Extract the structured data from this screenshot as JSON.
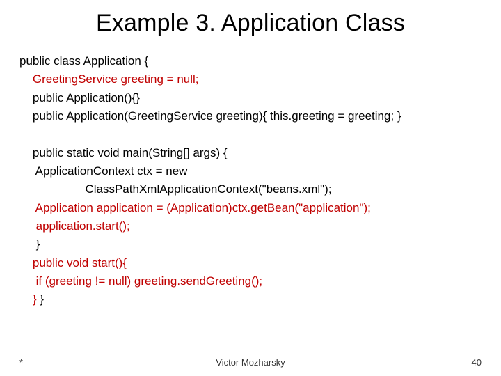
{
  "title": "Example 3. Application Class",
  "code": {
    "l1": "public class Application {",
    "l2": "    GreetingService greeting = null;",
    "l3": "    public Application(){}",
    "l4": "    public Application(GreetingService greeting){ this.greeting = greeting; }",
    "l5": "",
    "l6": "    public static void main(String[] args) {",
    "l7": "     ApplicationContext ctx = new",
    "l8": "                    ClassPathXmlApplicationContext(\"beans.xml\");",
    "l9": "     Application application = (Application)ctx.getBean(\"application\");",
    "l10": "     application.start();",
    "l11": "     }",
    "l12": "    public void start(){",
    "l13": "     if (greeting != null) greeting.sendGreeting();",
    "l14_a": "    }",
    "l14_b": " }"
  },
  "footer": {
    "left": "*",
    "center": "Victor Mozharsky",
    "right": "40"
  }
}
